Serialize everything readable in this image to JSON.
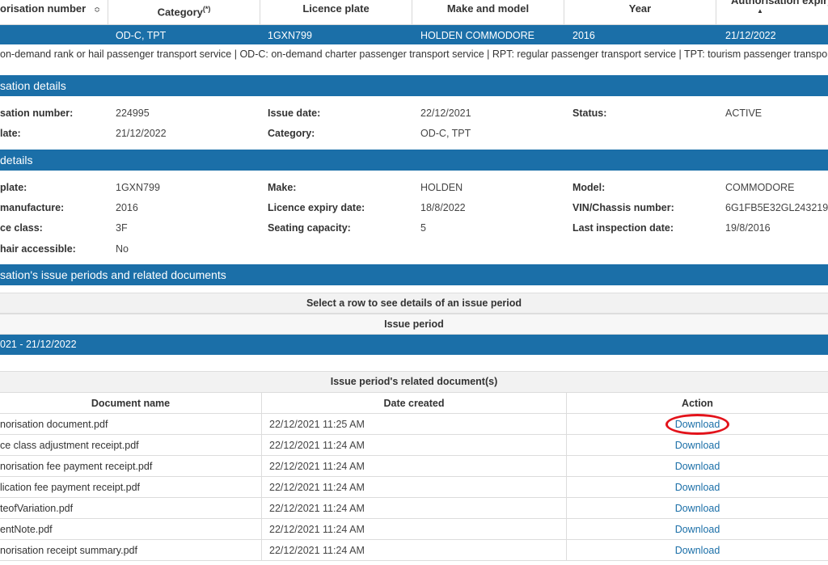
{
  "table_header": {
    "authorisation_number": "orisation number",
    "authorisation_number_sort": "≎",
    "category": "Category",
    "category_sup": "(*)",
    "licence_plate": "Licence plate",
    "make_and_model": "Make and model",
    "year": "Year",
    "authorisation_expiry": "Authorisation expiry",
    "authorisation_expiry_sort": "▲"
  },
  "selected_row": {
    "category": "OD-C, TPT",
    "licence_plate": "1GXN799",
    "make_and_model": "HOLDEN COMMODORE",
    "year": "2016",
    "authorisation_expiry": "21/12/2022"
  },
  "category_legend": "on-demand rank or hail passenger transport service | OD-C: on-demand charter passenger transport service | RPT: regular passenger transport service | TPT: tourism passenger transport service",
  "authorisation_details": {
    "heading": "sation details",
    "number_label": "sation number:",
    "number_value": "224995",
    "issue_date_label": "Issue date:",
    "issue_date_value": "22/12/2021",
    "status_label": "Status:",
    "status_value": "ACTIVE",
    "expiry_label": "late:",
    "expiry_value": "21/12/2022",
    "category_label": "Category:",
    "category_value": "OD-C, TPT"
  },
  "vehicle_details": {
    "heading": "details",
    "plate_label": "plate:",
    "plate_value": "1GXN799",
    "make_label": "Make:",
    "make_value": "HOLDEN",
    "model_label": "Model:",
    "model_value": "COMMODORE",
    "manufacture_label": "manufacture:",
    "manufacture_value": "2016",
    "licence_expiry_label": "Licence expiry date:",
    "licence_expiry_value": "18/8/2022",
    "vin_label": "VIN/Chassis number:",
    "vin_value": "6G1FB5E32GL243219",
    "service_class_label": "ce class:",
    "service_class_value": "3F",
    "seating_label": "Seating capacity:",
    "seating_value": "5",
    "last_inspection_label": "Last inspection date:",
    "last_inspection_value": "19/8/2016",
    "wheelchair_label": "hair accessible:",
    "wheelchair_value": "No"
  },
  "issue_periods": {
    "heading": "sation's issue periods and related documents",
    "select_hint": "Select a row to see details of an issue period",
    "column": "Issue period",
    "selected_period": "021 - 21/12/2022"
  },
  "documents": {
    "heading": "Issue period's related document(s)",
    "col_name": "Document name",
    "col_date": "Date created",
    "col_action": "Action",
    "rows": [
      {
        "name": "norisation document.pdf",
        "date": "22/12/2021 11:25 AM",
        "action": "Download"
      },
      {
        "name": "ce class adjustment receipt.pdf",
        "date": "22/12/2021 11:24 AM",
        "action": "Download"
      },
      {
        "name": "norisation fee payment receipt.pdf",
        "date": "22/12/2021 11:24 AM",
        "action": "Download"
      },
      {
        "name": "lication fee payment receipt.pdf",
        "date": "22/12/2021 11:24 AM",
        "action": "Download"
      },
      {
        "name": "teofVariation.pdf",
        "date": "22/12/2021 11:24 AM",
        "action": "Download"
      },
      {
        "name": "entNote.pdf",
        "date": "22/12/2021 11:24 AM",
        "action": "Download"
      },
      {
        "name": "norisation receipt summary.pdf",
        "date": "22/12/2021 11:24 AM",
        "action": "Download"
      }
    ]
  },
  "colors": {
    "brand_blue": "#1b6fa8",
    "link": "#1b6fa8",
    "highlight_circle": "#e3131b"
  }
}
